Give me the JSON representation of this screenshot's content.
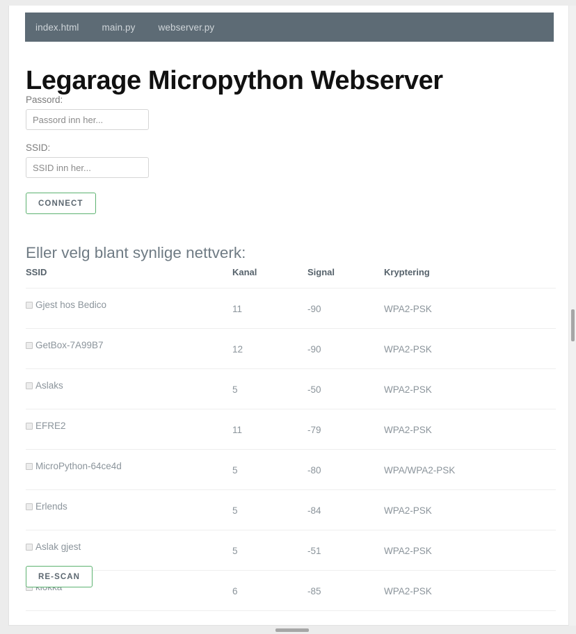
{
  "navbar": {
    "links": [
      {
        "label": "index.html"
      },
      {
        "label": "main.py"
      },
      {
        "label": "webserver.py"
      }
    ]
  },
  "page": {
    "title": "Legarage Micropython Webserver"
  },
  "form": {
    "password_label": "Passord:",
    "password_value": "",
    "password_placeholder": "Passord inn her...",
    "ssid_label": "SSID:",
    "ssid_value": "",
    "ssid_placeholder": "SSID inn her...",
    "connect_label": "CONNECT"
  },
  "networks_section": {
    "heading": "Eller velg blant synlige nettverk:",
    "columns": [
      "SSID",
      "Kanal",
      "Signal",
      "Kryptering"
    ],
    "rows": [
      {
        "ssid": "Gjest hos Bedico",
        "kanal": "11",
        "signal": "-90",
        "kryptering": "WPA2-PSK"
      },
      {
        "ssid": "GetBox-7A99B7",
        "kanal": "12",
        "signal": "-90",
        "kryptering": "WPA2-PSK"
      },
      {
        "ssid": "Aslaks",
        "kanal": "5",
        "signal": "-50",
        "kryptering": "WPA2-PSK"
      },
      {
        "ssid": "EFRE2",
        "kanal": "11",
        "signal": "-79",
        "kryptering": "WPA2-PSK"
      },
      {
        "ssid": "MicroPython-64ce4d",
        "kanal": "5",
        "signal": "-80",
        "kryptering": "WPA/WPA2-PSK"
      },
      {
        "ssid": "Erlends",
        "kanal": "5",
        "signal": "-84",
        "kryptering": "WPA2-PSK"
      },
      {
        "ssid": "Aslak gjest",
        "kanal": "5",
        "signal": "-51",
        "kryptering": "WPA2-PSK"
      },
      {
        "ssid": "klokka",
        "kanal": "6",
        "signal": "-85",
        "kryptering": "WPA2-PSK"
      }
    ],
    "rescan_label": "RE-SCAN"
  },
  "colors": {
    "navbar_bg": "#5d6b75",
    "button_border": "#5cb270",
    "button_text": "#5c6770",
    "heading_text": "#6f7b84",
    "table_text": "#8b949b",
    "page_bg": "#ececec"
  }
}
